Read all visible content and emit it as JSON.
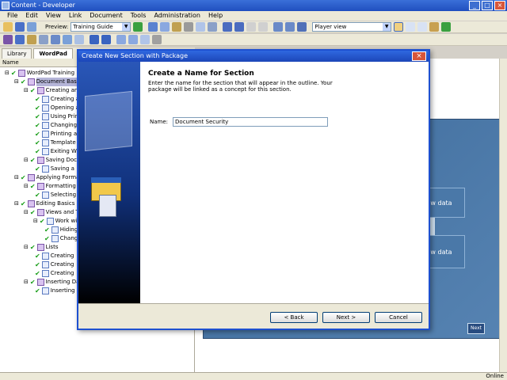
{
  "window": {
    "title": "Content - Developer"
  },
  "menu": [
    "File",
    "Edit",
    "View",
    "Link",
    "Document",
    "Tools",
    "Administration",
    "Help"
  ],
  "toolbar": {
    "preview_label": "Preview:",
    "preview_value": "Training Guide",
    "view_value": "Player view"
  },
  "tabs": [
    "Library",
    "WordPad"
  ],
  "tree": {
    "header": "Name",
    "nodes": [
      "WordPad Training",
      "Document Basics",
      "Creating and",
      "Creating a",
      "Opening a",
      "Using Prin",
      "Changing",
      "Printing a",
      "Template",
      "Exiting W",
      "Saving Docum",
      "Saving a",
      "Applying Formatt",
      "Formatting Pa",
      "Selecting",
      "Editing Basics",
      "Views and To",
      "Work with",
      "Hiding",
      "Chang",
      "Lists",
      "Creating",
      "Creating",
      "Creating",
      "Inserting Data",
      "Inserting"
    ]
  },
  "preview": {
    "box1": "new data",
    "box2": "new data",
    "next": "Next"
  },
  "dialog": {
    "title": "Create New Section with Package",
    "heading": "Create a Name for Section",
    "description": "Enter the name for the section that will appear in the outline. Your package will be linked as a concept for this section.",
    "name_label": "Name:",
    "name_value": "Document Security",
    "back": "< Back",
    "next": "Next >",
    "cancel": "Cancel"
  },
  "status": {
    "online": "Online"
  }
}
